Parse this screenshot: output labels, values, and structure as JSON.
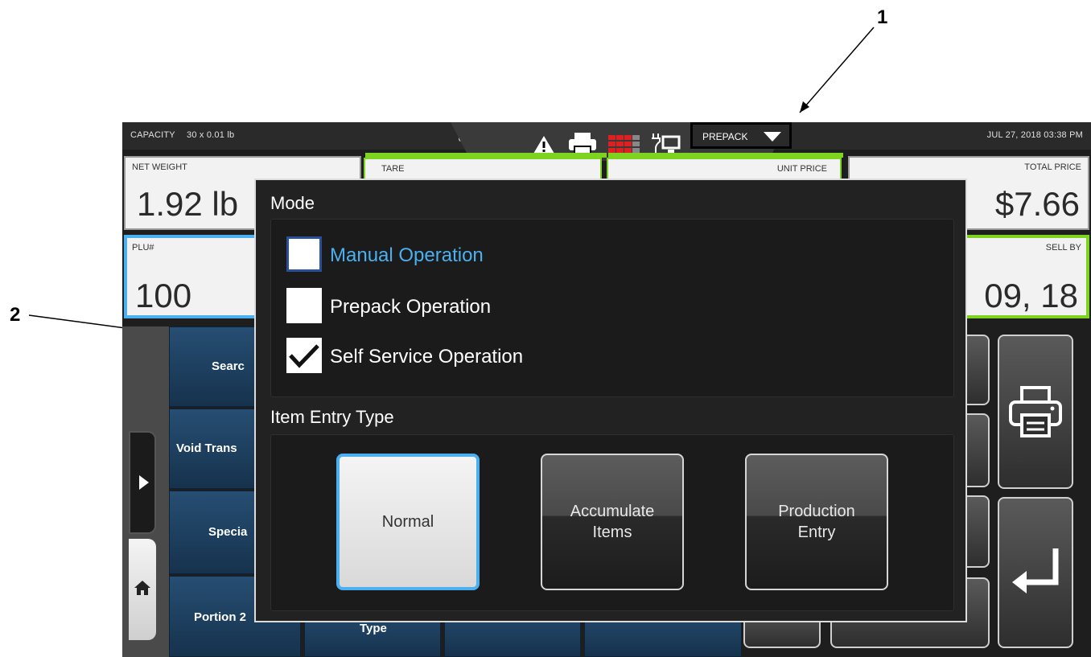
{
  "callouts": [
    "1",
    "2"
  ],
  "status_bar": {
    "capacity_label": "CAPACITY",
    "capacity_value": "30 x 0.01 lb",
    "mode_dropdown": "PREPACK",
    "datetime": "JUL 27, 2018 03:38 PM",
    "icons": [
      "warning-icon",
      "printer-icon",
      "keypad-grid-icon",
      "network-computer-icon"
    ]
  },
  "panels": {
    "net_weight_label": "NET WEIGHT",
    "net_weight_value": "1.92 lb",
    "tare_label": "TARE",
    "unit_price_label": "UNIT PRICE",
    "total_price_label": "TOTAL PRICE",
    "total_price_value": "$7.66",
    "plu_label": "PLU#",
    "plu_value": "100",
    "sell_by_label": "SELL BY",
    "sell_by_value": "09, 18"
  },
  "nav_tiles": [
    "Searc",
    "Void Trans",
    "Specia",
    "Portion 2"
  ],
  "bottom_tile_text": "Type",
  "modal": {
    "mode_title": "Mode",
    "options": [
      {
        "label": "Manual Operation",
        "checked": false,
        "focused": true
      },
      {
        "label": "Prepack Operation",
        "checked": false,
        "focused": false
      },
      {
        "label": "Self Service Operation",
        "checked": true,
        "focused": false
      }
    ],
    "item_entry_title": "Item Entry Type",
    "entry_buttons": [
      {
        "line1": "Normal",
        "line2": "",
        "selected": true
      },
      {
        "line1": "Accumulate",
        "line2": "Items",
        "selected": false
      },
      {
        "line1": "Production",
        "line2": "Entry",
        "selected": false
      }
    ]
  },
  "colors": {
    "accent_blue": "#4ab0f0",
    "accent_green": "#7ed321",
    "tile_blue": "#1f4263"
  }
}
